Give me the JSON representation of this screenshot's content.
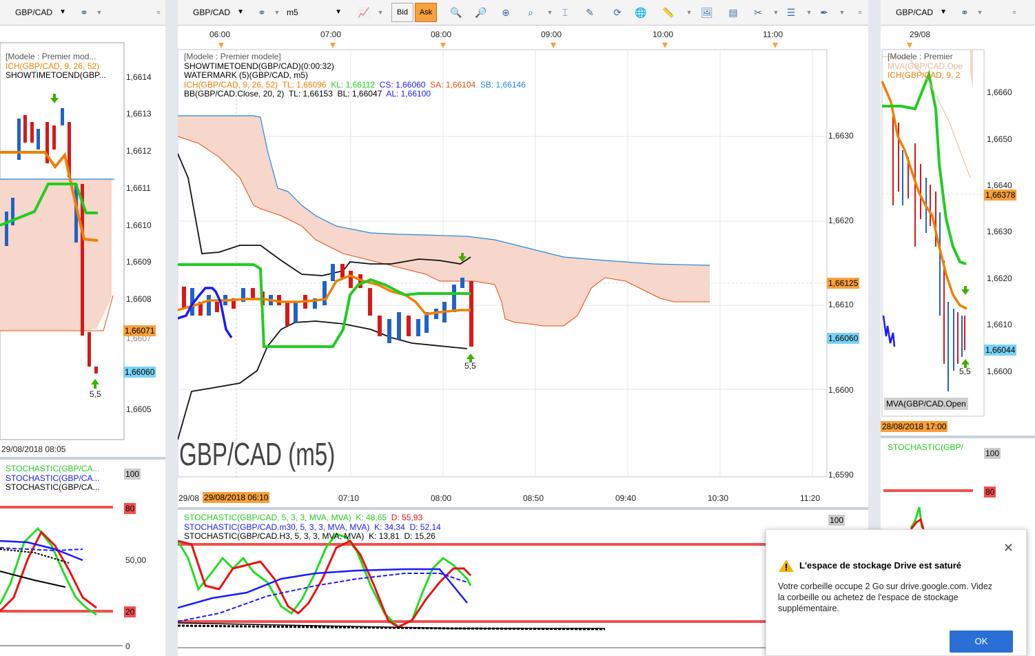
{
  "left_pane": {
    "symbol": "GBP/CAD",
    "legend": [
      "[Modele : Premier mod...",
      "ICH(GBP/CAD, 9, 26, 52)",
      "SHOWTIMETOEND(GBP..."
    ],
    "price_ticks": [
      "1,6614",
      "1,6613",
      "1,6612",
      "1,6611",
      "1,6610",
      "1,6609",
      "1,6608",
      "1,6607",
      "1,6605"
    ],
    "tag_orange": "1,66071",
    "tag_blue": "1,66060",
    "signal_label": "5,5",
    "date_label": "29/08/2018 08:05",
    "stoch_legend": [
      "STOCHASTIC(GBP/CA...",
      "STOCHASTIC(GBP/CA...",
      "STOCHASTIC(GBP/CA..."
    ],
    "stoch_ticks": [
      "100",
      "80",
      "50,00",
      "20",
      "0"
    ]
  },
  "main": {
    "symbol": "GBP/CAD",
    "timeframe": "m5",
    "bid_label": "Bid",
    "ask_label": "Ask",
    "top_times": [
      "06:00",
      "07:00",
      "08:00",
      "09:00",
      "10:00",
      "11:00"
    ],
    "legend": [
      {
        "text": "[Modele : Premier modele]",
        "color": "#555555"
      },
      {
        "text": "SHOWTIMETOEND(GBP/CAD)(0:00:32)",
        "color": "#000000"
      },
      {
        "text": "WATERMARK (5)(GBP/CAD, m5)",
        "color": "#000000"
      }
    ],
    "ich_line": [
      {
        "text": "ICH(GBP/CAD, 9, 26, 52)",
        "color": "#f08000"
      },
      {
        "text": "TL: 1,66096",
        "color": "#f08000"
      },
      {
        "text": "KL: 1,66112",
        "color": "#22cc22"
      },
      {
        "text": "CS: 1,66060",
        "color": "#1a1aff"
      },
      {
        "text": "SA: 1,66104",
        "color": "#e05010"
      },
      {
        "text": "SB: 1,66146",
        "color": "#2288dd"
      }
    ],
    "bb_line": [
      {
        "text": "BB(GBP/CAD.Close, 20, 2)",
        "color": "#000000"
      },
      {
        "text": "TL: 1,66153",
        "color": "#000000"
      },
      {
        "text": "BL: 1,66047",
        "color": "#000000"
      },
      {
        "text": "AL: 1,66100",
        "color": "#1a1aff"
      }
    ],
    "price_ticks": [
      "1,6630",
      "1,6620",
      "1,6610",
      "1,6600",
      "1,6590"
    ],
    "tag_orange": "1,66125",
    "tag_blue": "1,66060",
    "signal_label": "5,5",
    "watermark": "GBP/CAD (m5)",
    "bottom_times": [
      "29/08",
      "29/08/2018 06:10",
      "07:10",
      "08:00",
      "08:50",
      "09:40",
      "10:30",
      "11:20"
    ],
    "stoch_legend": [
      {
        "text": "STOCHASTIC(GBP/CAD, 5, 3, 3, MVA, MVA)",
        "color": "#22cc22"
      },
      {
        "text": "K: 48,65",
        "color": "#22cc22"
      },
      {
        "text": "D: 55,93",
        "color": "#ee1111"
      },
      {
        "text": "STOCHASTIC(GBP/CAD.m30, 5, 3, 3, MVA, MVA)",
        "color": "#1a1aff"
      },
      {
        "text": "K: 34,34",
        "color": "#1a1aff"
      },
      {
        "text": "D: 52,14",
        "color": "#1a1aff"
      },
      {
        "text": "STOCHASTIC(GBP/CAD.H3, 5, 3, 3, MVA, MVA)",
        "color": "#000000"
      },
      {
        "text": "K: 13,81",
        "color": "#000000"
      },
      {
        "text": "D: 15,26",
        "color": "#000000"
      }
    ],
    "stoch_tick_top": "100"
  },
  "right_pane": {
    "symbol": "GBP/CAD",
    "top_date": "29/08",
    "legend": [
      "[Modele : Premier",
      "MVA(GBP/CAD.Ope",
      "ICH(GBP/CAD, 9, 2"
    ],
    "price_ticks": [
      "1,6660",
      "1,6650",
      "1,6640",
      "1,6630",
      "1,6620",
      "1,6610",
      "1,6600"
    ],
    "tag_orange": "1,66378",
    "tag_blue": "1,66044",
    "signal_label": "5,5",
    "mva_label": "MVA(GBP/CAD.Open",
    "date_label": "28/08/2018 17:00",
    "stoch_legend": "STOCHASTIC(GBP/",
    "stoch_ticks": [
      "100",
      "80"
    ]
  },
  "notification": {
    "title": "L'espace de stockage Drive est saturé",
    "message": "Votre corbeille occupe 2 Go sur drive.google.com. Videz la corbeille ou achetez de l'espace de stockage supplémentaire.",
    "ok_label": "OK"
  },
  "colors": {
    "cloud": "#f7d6cb",
    "cloud_edge_a": "#e05010",
    "cloud_edge_b": "#2288dd",
    "tenkan": "#f08000",
    "kijun": "#22cc22",
    "chikou": "#1a1aff",
    "bollinger": "#000000",
    "up_candle": "#1f63c6",
    "down_candle": "#d81818",
    "tag_orange": "#f7a13c",
    "tag_blue": "#7ad2f5"
  }
}
